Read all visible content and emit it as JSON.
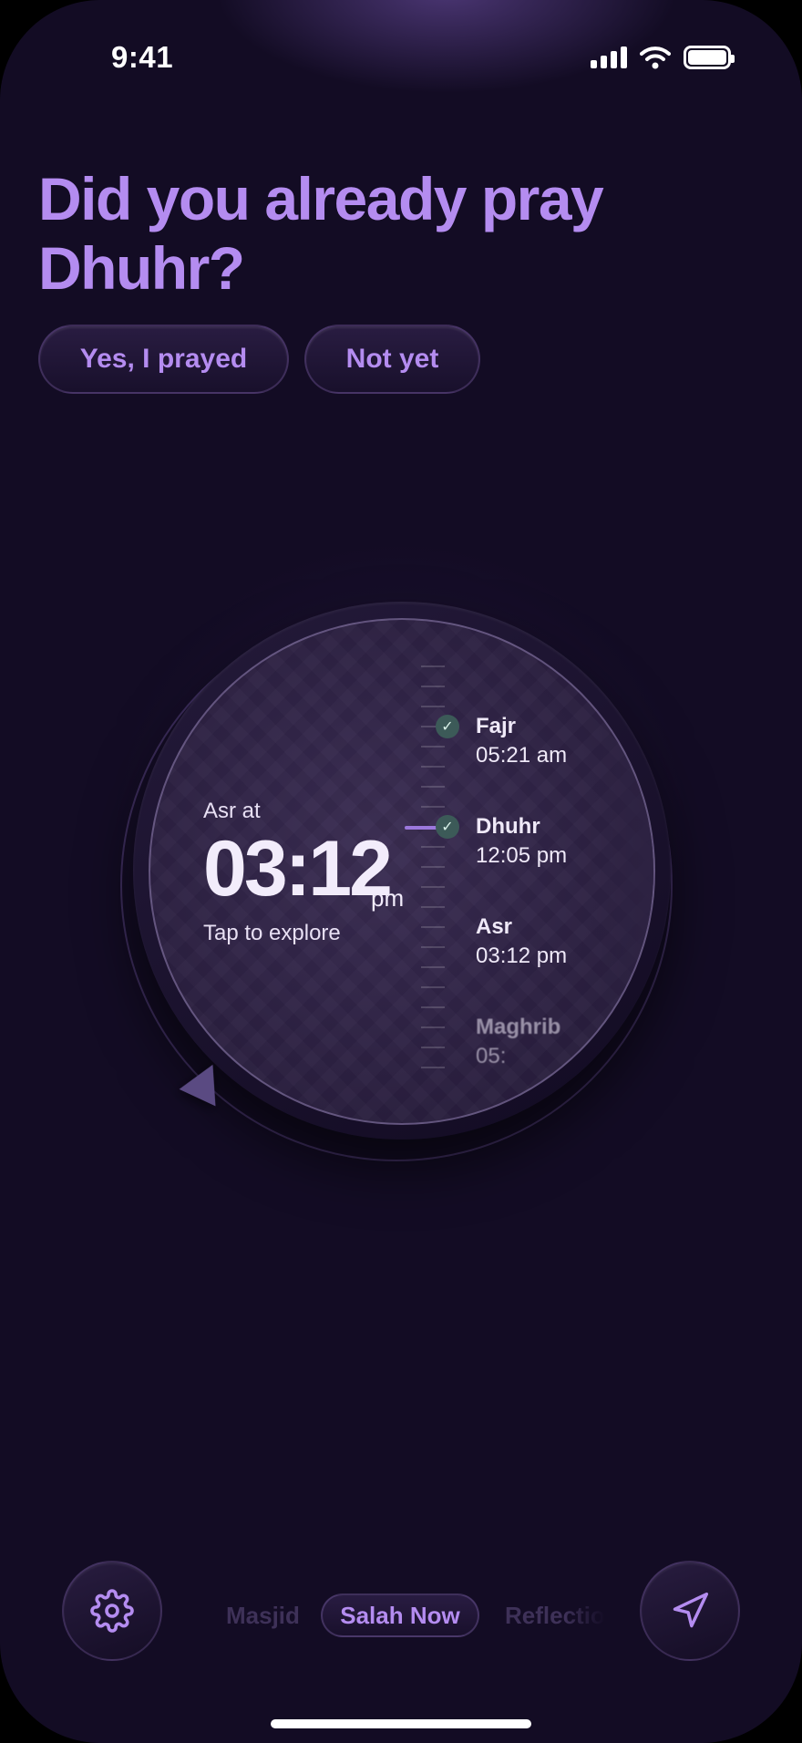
{
  "status_bar": {
    "time": "9:41"
  },
  "question": {
    "text": "Did you already pray Dhuhr?"
  },
  "answers": {
    "yes": "Yes, I prayed",
    "no": "Not yet"
  },
  "dial": {
    "next_label": "Asr at",
    "next_time": "03:12",
    "next_ampm": "pm",
    "hint": "Tap to explore",
    "prayers": [
      {
        "name": "Fajr",
        "time": "05:21 am",
        "done": true
      },
      {
        "name": "Dhuhr",
        "time": "12:05 pm",
        "done": true
      },
      {
        "name": "Asr",
        "time": "03:12 pm",
        "done": false
      },
      {
        "name": "Maghrib",
        "time": "05:",
        "done": false
      }
    ]
  },
  "nav": {
    "left": "Masjid",
    "center": "Salah Now",
    "right": "Reflections"
  },
  "colors": {
    "accent": "#b48cf0",
    "background": "#130c24",
    "check": "#3c5a58"
  },
  "icons": {
    "settings": "gear-icon",
    "locate": "navigation-arrow-icon"
  }
}
